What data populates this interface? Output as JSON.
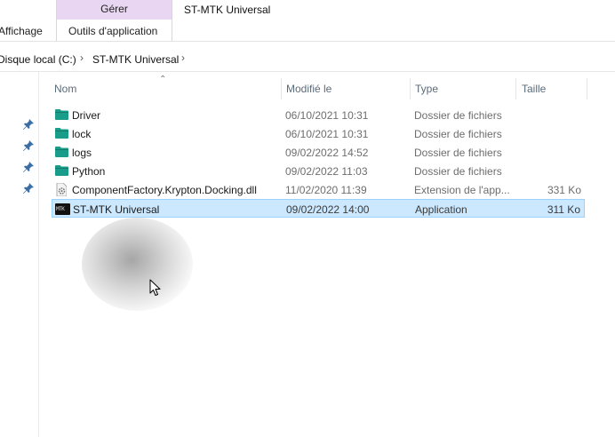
{
  "ribbon": {
    "context_group_label": "Gérer",
    "window_title": "ST-MTK Universal",
    "tabs": [
      {
        "label": "Affichage"
      },
      {
        "label": "Outils d'application"
      }
    ],
    "context_color": "#e9d6f3"
  },
  "address": {
    "segments": [
      {
        "label": "Disque local (C:)"
      },
      {
        "label": "ST-MTK Universal"
      }
    ],
    "separator_icon": "chevron-right-icon"
  },
  "nav": {
    "pins": [
      "pin-icon",
      "pin-icon",
      "pin-icon",
      "pin-icon"
    ]
  },
  "columns": {
    "name": "Nom",
    "modified": "Modifié le",
    "type": "Type",
    "size": "Taille",
    "sort_icon": "sort-up-icon"
  },
  "files": [
    {
      "name": "Driver",
      "modified": "06/10/2021 10:31",
      "type": "Dossier de fichiers",
      "size": "",
      "icon": "folder-icon"
    },
    {
      "name": "lock",
      "modified": "06/10/2021 10:31",
      "type": "Dossier de fichiers",
      "size": "",
      "icon": "folder-icon"
    },
    {
      "name": "logs",
      "modified": "09/02/2022 14:52",
      "type": "Dossier de fichiers",
      "size": "",
      "icon": "folder-icon"
    },
    {
      "name": "Python",
      "modified": "09/02/2022 11:03",
      "type": "Dossier de fichiers",
      "size": "",
      "icon": "folder-icon"
    },
    {
      "name": "ComponentFactory.Krypton.Docking.dll",
      "modified": "11/02/2020 11:39",
      "type": "Extension de l'app...",
      "size": "331 Ko",
      "icon": "dll-icon"
    },
    {
      "name": "ST-MTK Universal",
      "modified": "09/02/2022 14:00",
      "type": "Application",
      "size": "311 Ko",
      "icon": "app-icon",
      "selected": true
    }
  ],
  "colors": {
    "folder": "#1a9c8a",
    "selection_bg": "#cce8ff",
    "selection_border": "#99d1ff"
  }
}
